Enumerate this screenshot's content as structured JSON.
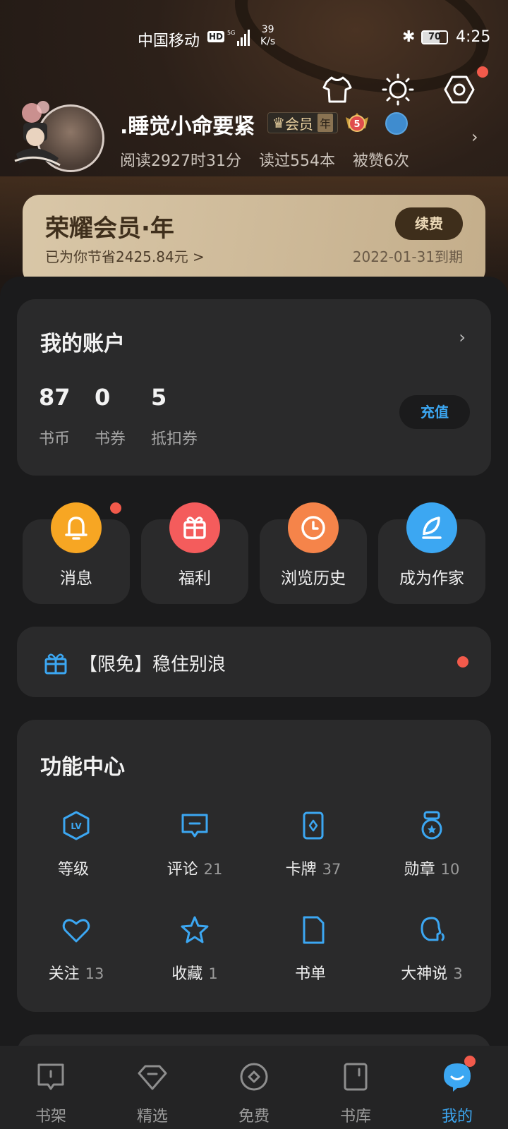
{
  "status_bar": {
    "carrier": "中国移动",
    "hd": "HD",
    "network": "5G",
    "speed_value": "39",
    "speed_unit": "K/s",
    "battery": "70",
    "time": "4:25"
  },
  "profile": {
    "username": ".睡觉小命要紧",
    "vip_label": "会员",
    "vip_term": "年",
    "level": "5",
    "stats": [
      "阅读2927时31分",
      "读过554本",
      "被赞6次"
    ]
  },
  "vip_card": {
    "title": "荣耀会员·年",
    "savings": "已为你节省2425.84元 >",
    "renew": "续费",
    "expire": "2022-01-31到期"
  },
  "account": {
    "title": "我的账户",
    "items": [
      {
        "value": "87",
        "label": "书币"
      },
      {
        "value": "0",
        "label": "书券"
      },
      {
        "value": "5",
        "label": "抵扣券"
      }
    ],
    "charge": "充值"
  },
  "quick_actions": [
    {
      "label": "消息",
      "icon": "bell-icon",
      "color": "#f7a623"
    },
    {
      "label": "福利",
      "icon": "gift-icon",
      "color": "#f45c5c"
    },
    {
      "label": "浏览历史",
      "icon": "clock-icon",
      "color": "#f5844a"
    },
    {
      "label": "成为作家",
      "icon": "quill-icon",
      "color": "#3ca7f2"
    }
  ],
  "promo": {
    "text": "【限免】稳住别浪"
  },
  "function_center": {
    "title": "功能中心",
    "items": [
      {
        "label": "等级",
        "count": "",
        "icon": "level-icon"
      },
      {
        "label": "评论",
        "count": "21",
        "icon": "comment-icon"
      },
      {
        "label": "卡牌",
        "count": "37",
        "icon": "card-icon"
      },
      {
        "label": "勋章",
        "count": "10",
        "icon": "medal-icon"
      },
      {
        "label": "关注",
        "count": "13",
        "icon": "heart-icon"
      },
      {
        "label": "收藏",
        "count": "1",
        "icon": "star-icon"
      },
      {
        "label": "书单",
        "count": "",
        "icon": "booklist-icon"
      },
      {
        "label": "大神说",
        "count": "3",
        "icon": "speaker-icon"
      }
    ]
  },
  "tabbar": [
    {
      "label": "书架",
      "icon": "bookshelf-icon"
    },
    {
      "label": "精选",
      "icon": "diamond-icon"
    },
    {
      "label": "免费",
      "icon": "free-icon"
    },
    {
      "label": "书库",
      "icon": "library-icon"
    },
    {
      "label": "我的",
      "icon": "mine-icon",
      "active": true
    }
  ],
  "colors": {
    "accent": "#3ca7f2",
    "badge": "#f25a4b"
  }
}
